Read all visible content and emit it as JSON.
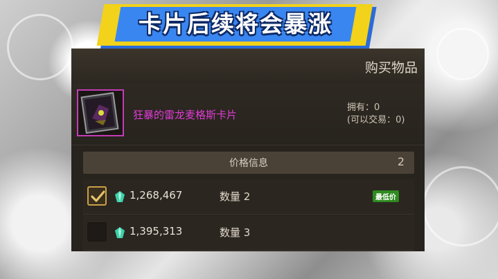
{
  "banner": {
    "text": "卡片后续将会暴涨"
  },
  "panel": {
    "title": "购买物品",
    "item": {
      "name": "狂暴的雷龙麦格斯卡片",
      "owned": "拥有：0",
      "tradable": "(可以交易：0)"
    },
    "price_info": {
      "label": "价格信息",
      "count": "2"
    },
    "listings": [
      {
        "price": "1,268,467",
        "quantity": "数量 2",
        "badge": "最低价",
        "checked": true
      },
      {
        "price": "1,395,313",
        "quantity": "数量 3",
        "badge": "",
        "checked": false
      }
    ]
  },
  "colors": {
    "banner_yellow": "#f2d21a",
    "banner_blue": "#3a86f0",
    "item_name_magenta": "#e23bd8",
    "badge_green": "#2e8a1f",
    "check_gold": "#c9a04a"
  },
  "icons": {
    "check": "check-icon",
    "currency": "gem-icon",
    "card": "card-thumbnail-icon"
  }
}
